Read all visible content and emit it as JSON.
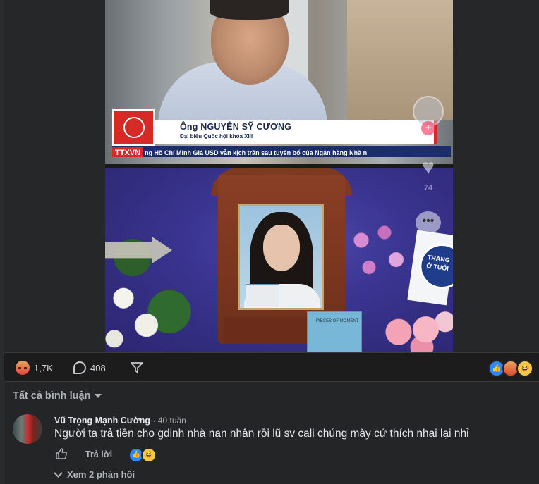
{
  "video": {
    "lower_third": {
      "name": "Ông NGUYỄN SỸ CƯƠNG",
      "title": "Đại biểu Quốc hội khóa XIII",
      "channel_logo": "TTXVN",
      "ticker": "ng Hồ Chí Minh      Giá USD vẫn kịch trần sau tuyên bố của Ngân hàng Nhà n"
    },
    "book_text": "PIECES OF MOMENT",
    "sign_text": "TRANG Ở TUỔI",
    "overlay": {
      "like_count": "74",
      "plus_symbol": "+",
      "heart_symbol": "♥",
      "comment_symbol": "•••"
    }
  },
  "actions": {
    "reactions_count": "1,7K",
    "comments_count": "408",
    "reaction_cluster": [
      "like",
      "angry",
      "haha"
    ]
  },
  "comments": {
    "filter_label": "Tất cả bình luận",
    "items": [
      {
        "author": "Vũ Trọng Mạnh Cường",
        "time": "· 40 tuần",
        "text": "Người ta trả tiền cho gdinh nhà nạn nhân rồi lũ sv cali chúng mày cứ thích nhai lại nhỉ",
        "reply_label": "Trả lời",
        "reactions": [
          "like",
          "haha"
        ]
      }
    ],
    "view_replies": "Xem 2 phản hồi"
  },
  "colors": {
    "background": "#1c1c1d",
    "panel": "#242526",
    "accent_like": "#2e89ff",
    "tiktok_red": "#fe2c55"
  }
}
